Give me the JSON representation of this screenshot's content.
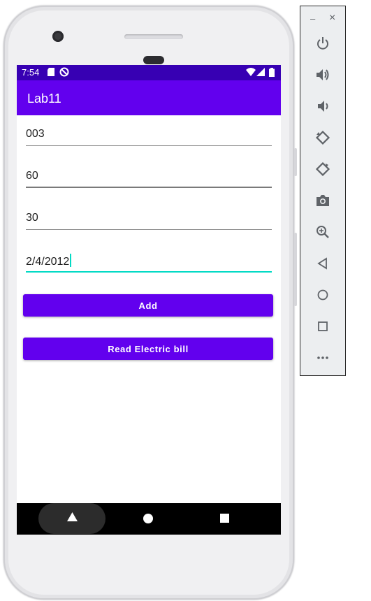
{
  "status_bar": {
    "time": "7:54"
  },
  "app_bar": {
    "title": "Lab11"
  },
  "form": {
    "fields": [
      {
        "value": "003"
      },
      {
        "value": "60"
      },
      {
        "value": "30"
      },
      {
        "value": "2/4/2012"
      }
    ],
    "add_button": "Add",
    "read_button": "Read Electric bill"
  },
  "emulator_panel": {
    "minimize": "–",
    "close": "×",
    "controls": [
      "power-icon",
      "volume-up-icon",
      "volume-down-icon",
      "rotate-left-icon",
      "rotate-right-icon",
      "camera-icon",
      "zoom-icon",
      "back-icon",
      "home-icon",
      "overview-icon",
      "more-icon"
    ]
  },
  "colors": {
    "status_bar": "#3700b3",
    "primary": "#6200ee",
    "accent": "#03dac5"
  }
}
